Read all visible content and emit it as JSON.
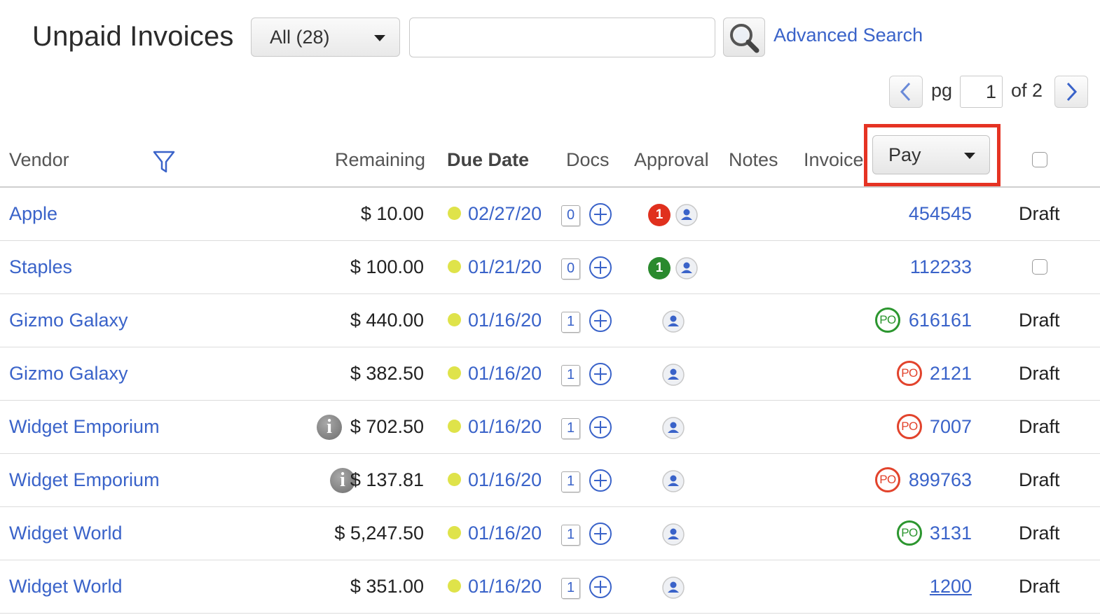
{
  "header": {
    "title": "Unpaid Invoices",
    "filter_value": "All (28)",
    "search_value": "",
    "search_icon": "search-icon",
    "advanced_search": "Advanced Search"
  },
  "pager": {
    "pg_label": "pg",
    "current_page": "1",
    "of_label": "of 2"
  },
  "columns": {
    "vendor": "Vendor",
    "remaining": "Remaining",
    "due_date": "Due Date",
    "docs": "Docs",
    "approval": "Approval",
    "notes": "Notes",
    "invoice": "Invoice",
    "pay_action": "Pay"
  },
  "colors": {
    "link": "#3a63c9",
    "highlight": "#e53323",
    "due_dot": "#dfe34a",
    "approval_red": "#e0301e",
    "approval_green": "#2a8a2e"
  },
  "rows": [
    {
      "vendor": "Apple",
      "remaining": "$ 10.00",
      "due": "02/27/20",
      "docs": "0",
      "approval_count": "1",
      "approval_color": "red",
      "invoice": "454545",
      "po": "",
      "status": "Draft"
    },
    {
      "vendor": "Staples",
      "remaining": "$ 100.00",
      "due": "01/21/20",
      "docs": "0",
      "approval_count": "1",
      "approval_color": "green",
      "invoice": "112233",
      "po": "",
      "status": ""
    },
    {
      "vendor": "Gizmo Galaxy",
      "remaining": "$ 440.00",
      "due": "01/16/20",
      "docs": "1",
      "approval_count": "",
      "approval_color": "",
      "invoice": "616161",
      "po": "green",
      "status": "Draft"
    },
    {
      "vendor": "Gizmo Galaxy",
      "remaining": "$ 382.50",
      "due": "01/16/20",
      "docs": "1",
      "approval_count": "",
      "approval_color": "",
      "invoice": "2121",
      "po": "red",
      "status": "Draft"
    },
    {
      "vendor": "Widget Emporium",
      "remaining": "$ 702.50",
      "due": "01/16/20",
      "docs": "1",
      "approval_count": "",
      "approval_color": "",
      "invoice": "7007",
      "po": "red",
      "status": "Draft",
      "info": true
    },
    {
      "vendor": "Widget Emporium",
      "remaining": "$ 137.81",
      "due": "01/16/20",
      "docs": "1",
      "approval_count": "",
      "approval_color": "",
      "invoice": "899763",
      "po": "red",
      "status": "Draft",
      "info": true
    },
    {
      "vendor": "Widget World",
      "remaining": "$ 5,247.50",
      "due": "01/16/20",
      "docs": "1",
      "approval_count": "",
      "approval_color": "",
      "invoice": "3131",
      "po": "green",
      "status": "Draft"
    },
    {
      "vendor": "Widget World",
      "remaining": "$ 351.00",
      "due": "01/16/20",
      "docs": "1",
      "approval_count": "",
      "approval_color": "",
      "invoice": "1200",
      "po": "",
      "status": "Draft",
      "underline": true
    }
  ],
  "labels": {
    "po": "PO",
    "info": "i"
  }
}
